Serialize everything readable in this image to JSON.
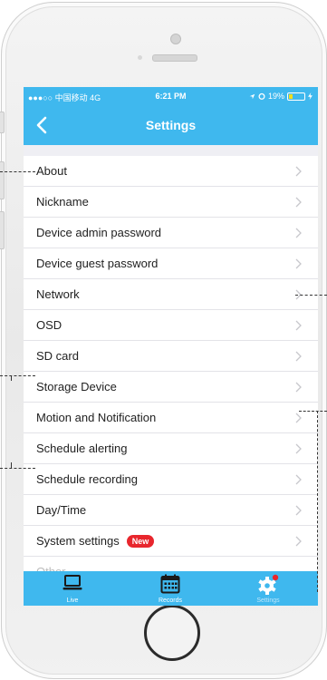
{
  "status_bar": {
    "carrier": "●●●○○ 中国移动  4G",
    "time": "6:21 PM",
    "battery_percent": "19%"
  },
  "nav_bar": {
    "title": "Settings",
    "back_icon": "chevron-left-icon"
  },
  "settings_items": [
    {
      "label": "About"
    },
    {
      "label": "Nickname"
    },
    {
      "label": "Device admin password"
    },
    {
      "label": "Device guest password"
    },
    {
      "label": "Network"
    },
    {
      "label": "OSD"
    },
    {
      "label": "SD card"
    },
    {
      "label": "Storage Device"
    },
    {
      "label": "Motion and Notification"
    },
    {
      "label": "Schedule alerting"
    },
    {
      "label": "Schedule recording"
    },
    {
      "label": "Day/Time"
    },
    {
      "label": "System settings",
      "badge": "New"
    },
    {
      "label": "Other"
    }
  ],
  "tab_bar": {
    "tabs": [
      {
        "label": "Live",
        "icon": "laptop-icon"
      },
      {
        "label": "Records",
        "icon": "calendar-icon"
      },
      {
        "label": "Settings",
        "icon": "gear-icon",
        "active": true,
        "notification_dot": true
      }
    ]
  },
  "colors": {
    "accent": "#3fb8ee",
    "badge": "#e8262d",
    "background": "#efeff4"
  }
}
